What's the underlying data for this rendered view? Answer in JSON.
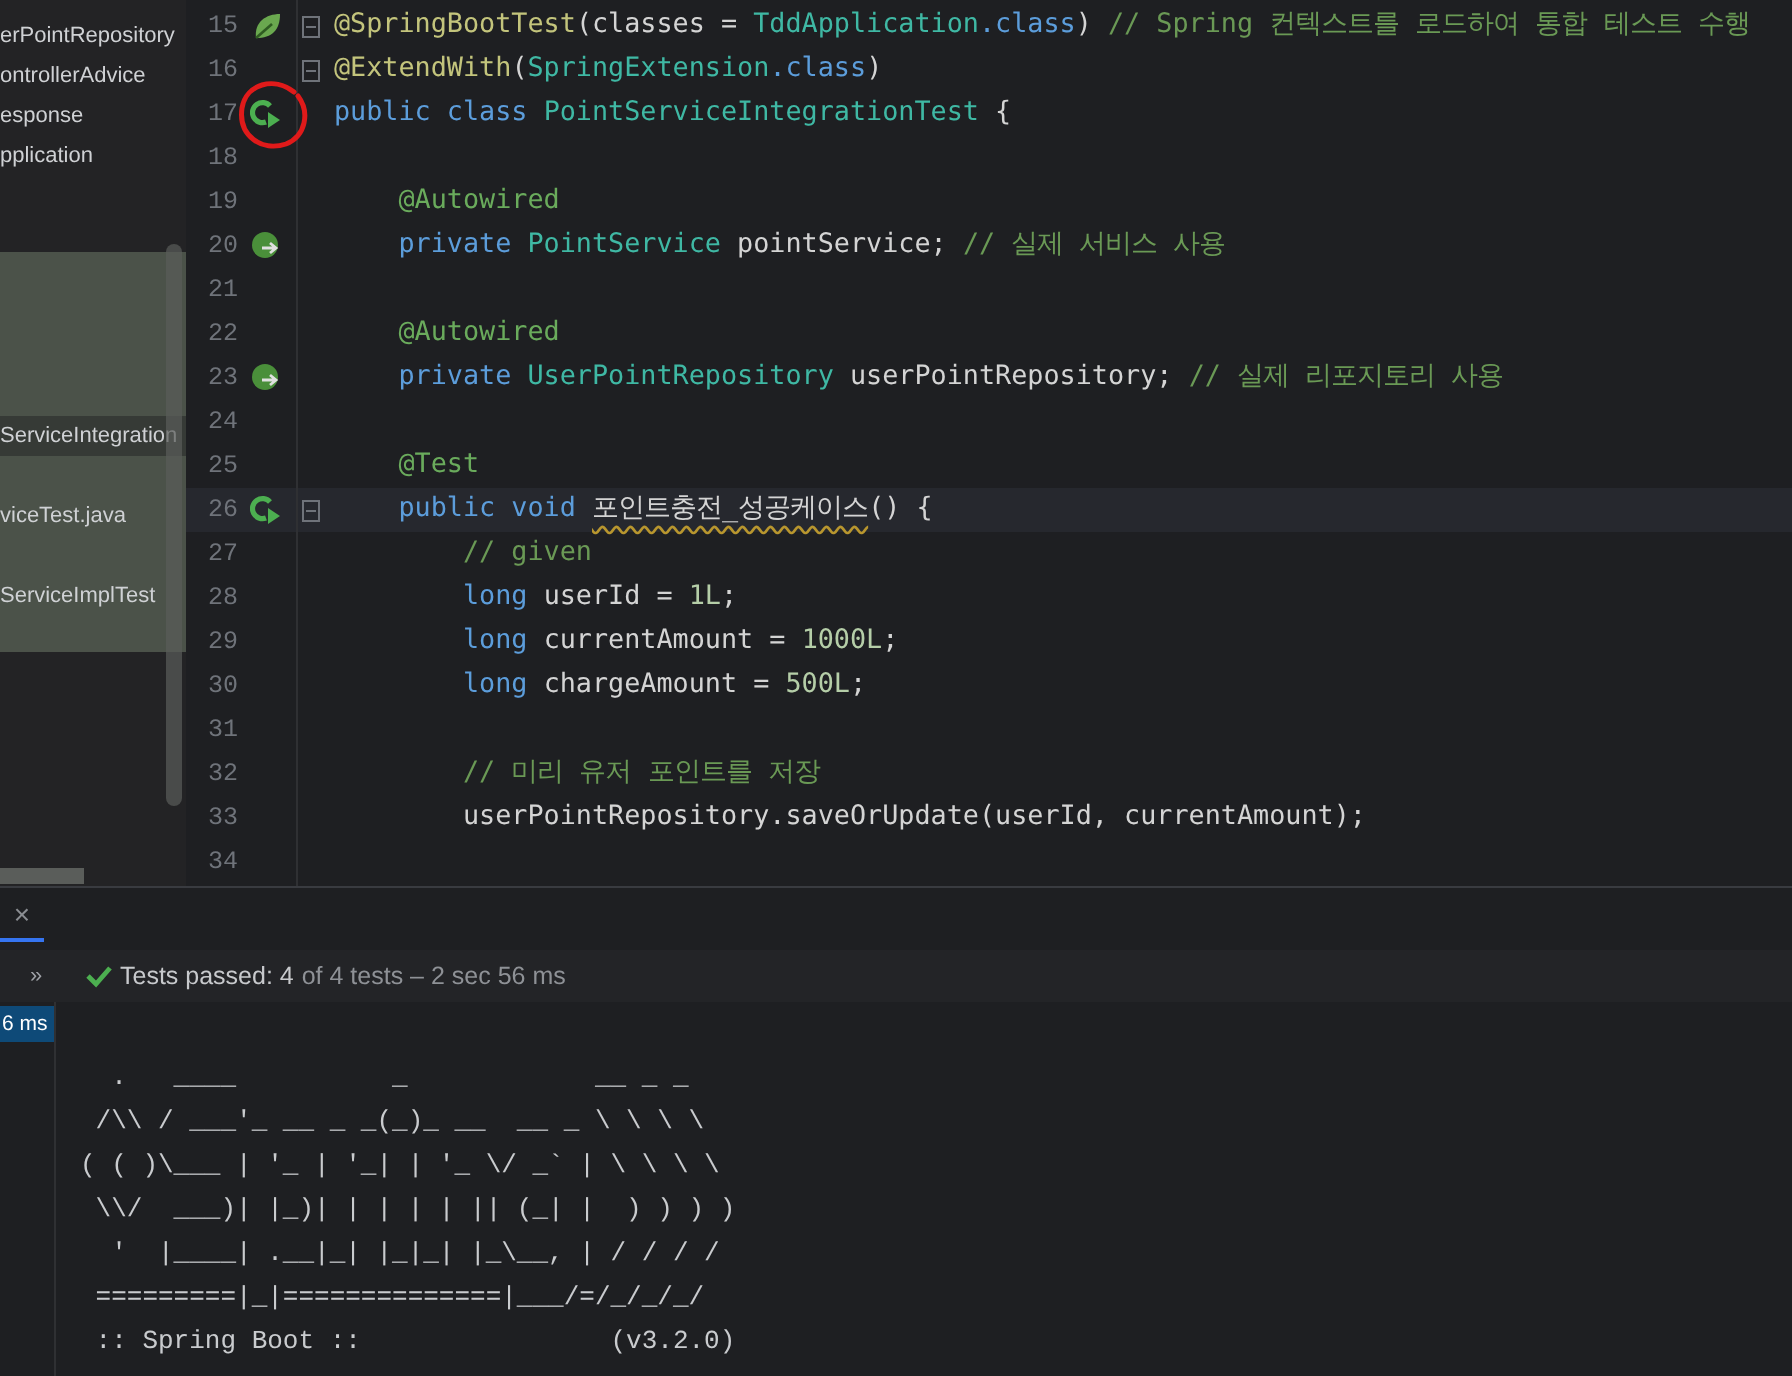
{
  "project_tree": {
    "items": [
      {
        "label": "erPointRepository",
        "selected": false,
        "current": false
      },
      {
        "label": "ontrollerAdvice",
        "selected": false,
        "current": false
      },
      {
        "label": "esponse",
        "selected": false,
        "current": false
      },
      {
        "label": "pplication",
        "selected": false,
        "current": false
      },
      {
        "label": "ServiceIntegration",
        "selected": true,
        "current": true
      },
      {
        "label": "viceTest.java",
        "selected": true,
        "current": false
      },
      {
        "label": "ServiceImplTest",
        "selected": true,
        "current": false
      }
    ]
  },
  "editor": {
    "lines": [
      {
        "number": "15",
        "kind": "spring",
        "fold": true,
        "current": false,
        "circled": false,
        "tokens": [
          {
            "text": "@SpringBootTest",
            "kind": "meta"
          },
          {
            "text": "(classes = ",
            "kind": "plain"
          },
          {
            "text": "TddApplication",
            "kind": "type"
          },
          {
            "text": ".class",
            "kind": "keyword"
          },
          {
            "text": ") ",
            "kind": "plain"
          },
          {
            "text": "// Spring 컨텍스트를 로드하여 통합 테스트 수행",
            "kind": "comment"
          }
        ]
      },
      {
        "number": "16",
        "kind": "plain",
        "fold": true,
        "current": false,
        "circled": false,
        "tokens": [
          {
            "text": "@ExtendWith",
            "kind": "meta"
          },
          {
            "text": "(",
            "kind": "plain"
          },
          {
            "text": "SpringExtension",
            "kind": "type"
          },
          {
            "text": ".class",
            "kind": "keyword"
          },
          {
            "text": ")",
            "kind": "plain"
          }
        ]
      },
      {
        "number": "17",
        "kind": "run",
        "fold": false,
        "current": false,
        "circled": true,
        "tokens": [
          {
            "text": "public class ",
            "kind": "keyword"
          },
          {
            "text": "PointServiceIntegrationTest",
            "kind": "type"
          },
          {
            "text": " {",
            "kind": "plain"
          }
        ]
      },
      {
        "number": "18",
        "kind": "plain",
        "fold": false,
        "current": false,
        "circled": false
      },
      {
        "number": "19",
        "kind": "plain",
        "fold": false,
        "current": false,
        "circled": false,
        "tokens": [
          {
            "text": "    @Autowired",
            "kind": "annotation"
          }
        ]
      },
      {
        "number": "20",
        "kind": "bean",
        "fold": false,
        "current": false,
        "circled": false,
        "tokens": [
          {
            "text": "    private ",
            "kind": "keyword"
          },
          {
            "text": "PointService",
            "kind": "type"
          },
          {
            "text": " pointService; ",
            "kind": "plain"
          },
          {
            "text": "// 실제 서비스 사용",
            "kind": "comment"
          }
        ]
      },
      {
        "number": "21",
        "kind": "plain",
        "fold": false,
        "current": false,
        "circled": false
      },
      {
        "number": "22",
        "kind": "plain",
        "fold": false,
        "current": false,
        "circled": false,
        "tokens": [
          {
            "text": "    @Autowired",
            "kind": "annotation"
          }
        ]
      },
      {
        "number": "23",
        "kind": "bean",
        "fold": false,
        "current": false,
        "circled": false,
        "tokens": [
          {
            "text": "    private ",
            "kind": "keyword"
          },
          {
            "text": "UserPointRepository",
            "kind": "type"
          },
          {
            "text": " userPointRepository; ",
            "kind": "plain"
          },
          {
            "text": "// 실제 리포지토리 사용",
            "kind": "comment"
          }
        ]
      },
      {
        "number": "24",
        "kind": "plain",
        "fold": false,
        "current": false,
        "circled": false
      },
      {
        "number": "25",
        "kind": "plain",
        "fold": false,
        "current": false,
        "circled": false,
        "tokens": [
          {
            "text": "    @Test",
            "kind": "annotation"
          }
        ]
      },
      {
        "number": "26",
        "kind": "run",
        "fold": true,
        "current": true,
        "circled": false,
        "tokens": [
          {
            "text": "    public void ",
            "kind": "keyword"
          },
          {
            "text": "포인트충전_성공케이스",
            "kind": "warning"
          },
          {
            "text": "() {",
            "kind": "plain"
          }
        ]
      },
      {
        "number": "27",
        "kind": "plain",
        "fold": false,
        "current": false,
        "circled": false,
        "tokens": [
          {
            "text": "        // given",
            "kind": "comment"
          }
        ]
      },
      {
        "number": "28",
        "kind": "plain",
        "fold": false,
        "current": false,
        "circled": false,
        "tokens": [
          {
            "text": "        long ",
            "kind": "keyword"
          },
          {
            "text": "userId = ",
            "kind": "plain"
          },
          {
            "text": "1L",
            "kind": "number"
          },
          {
            "text": ";",
            "kind": "plain"
          }
        ]
      },
      {
        "number": "29",
        "kind": "plain",
        "fold": false,
        "current": false,
        "circled": false,
        "tokens": [
          {
            "text": "        long ",
            "kind": "keyword"
          },
          {
            "text": "currentAmount = ",
            "kind": "plain"
          },
          {
            "text": "1000L",
            "kind": "number"
          },
          {
            "text": ";",
            "kind": "plain"
          }
        ]
      },
      {
        "number": "30",
        "kind": "plain",
        "fold": false,
        "current": false,
        "circled": false,
        "tokens": [
          {
            "text": "        long ",
            "kind": "keyword"
          },
          {
            "text": "chargeAmount = ",
            "kind": "plain"
          },
          {
            "text": "500L",
            "kind": "number"
          },
          {
            "text": ";",
            "kind": "plain"
          }
        ]
      },
      {
        "number": "31",
        "kind": "plain",
        "fold": false,
        "current": false,
        "circled": false
      },
      {
        "number": "32",
        "kind": "plain",
        "fold": false,
        "current": false,
        "circled": false,
        "tokens": [
          {
            "text": "        // 미리 유저 포인트를 저장",
            "kind": "comment"
          }
        ]
      },
      {
        "number": "33",
        "kind": "plain",
        "fold": false,
        "current": false,
        "circled": false,
        "tokens": [
          {
            "text": "        userPointRepository.saveOrUpdate(userId, currentAmount);",
            "kind": "plain"
          }
        ]
      },
      {
        "number": "34",
        "kind": "plain",
        "fold": false,
        "current": false,
        "circled": false
      }
    ]
  },
  "run_panel": {
    "close": "×",
    "expand": "»",
    "status": {
      "passed": true,
      "summary": "Tests passed: 4",
      "detail": "of 4 tests – 2 sec 56 ms"
    },
    "test_tree": [
      {
        "label": "6 ms",
        "selected": true
      }
    ],
    "console": [
      "  .   ____          _            __ _ _",
      " /\\\\ / ___'_ __ _ _(_)_ __  __ _ \\ \\ \\ \\",
      "( ( )\\___ | '_ | '_| | '_ \\/ _` | \\ \\ \\ \\",
      " \\\\/  ___)| |_)| | | | | || (_| |  ) ) ) )",
      "  '  |____| .__|_| |_|_| |_\\__, | / / / /",
      " =========|_|==============|___/=/_/_/_/",
      " :: Spring Boot ::                (v3.2.0)"
    ]
  }
}
